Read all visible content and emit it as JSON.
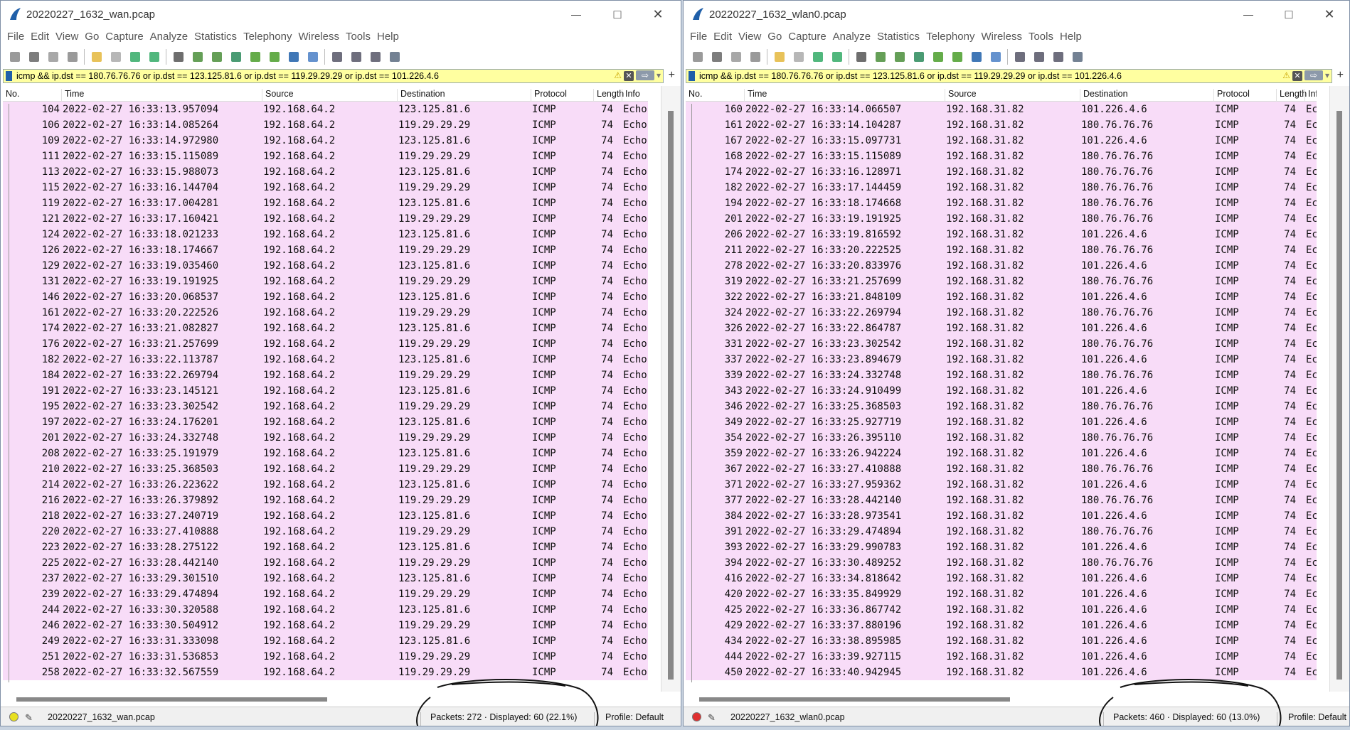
{
  "menu": [
    "File",
    "Edit",
    "View",
    "Go",
    "Capture",
    "Analyze",
    "Statistics",
    "Telephony",
    "Wireless",
    "Tools",
    "Help"
  ],
  "columns": [
    "No.",
    "Time",
    "Source",
    "Destination",
    "Protocol",
    "Length",
    "Info"
  ],
  "filter": "icmp && ip.dst == 180.76.76.76 or ip.dst == 123.125.81.6 or ip.dst == 119.29.29.29 or ip.dst == 101.226.4.6",
  "profile": "Profile: Default",
  "windows": [
    {
      "title": "20220227_1632_wan.pcap",
      "file": "20220227_1632_wan.pcap",
      "stats": "Packets: 272 · Displayed: 60 (22.1%)",
      "led_color": "#e8e020",
      "rows": [
        [
          "104",
          "2022-02-27 16:33:13.957094",
          "192.168.64.2",
          "123.125.81.6",
          "ICMP",
          "74",
          "Echo"
        ],
        [
          "106",
          "2022-02-27 16:33:14.085264",
          "192.168.64.2",
          "119.29.29.29",
          "ICMP",
          "74",
          "Echo"
        ],
        [
          "109",
          "2022-02-27 16:33:14.972980",
          "192.168.64.2",
          "123.125.81.6",
          "ICMP",
          "74",
          "Echo"
        ],
        [
          "111",
          "2022-02-27 16:33:15.115089",
          "192.168.64.2",
          "119.29.29.29",
          "ICMP",
          "74",
          "Echo"
        ],
        [
          "113",
          "2022-02-27 16:33:15.988073",
          "192.168.64.2",
          "123.125.81.6",
          "ICMP",
          "74",
          "Echo"
        ],
        [
          "115",
          "2022-02-27 16:33:16.144704",
          "192.168.64.2",
          "119.29.29.29",
          "ICMP",
          "74",
          "Echo"
        ],
        [
          "119",
          "2022-02-27 16:33:17.004281",
          "192.168.64.2",
          "123.125.81.6",
          "ICMP",
          "74",
          "Echo"
        ],
        [
          "121",
          "2022-02-27 16:33:17.160421",
          "192.168.64.2",
          "119.29.29.29",
          "ICMP",
          "74",
          "Echo"
        ],
        [
          "124",
          "2022-02-27 16:33:18.021233",
          "192.168.64.2",
          "123.125.81.6",
          "ICMP",
          "74",
          "Echo"
        ],
        [
          "126",
          "2022-02-27 16:33:18.174667",
          "192.168.64.2",
          "119.29.29.29",
          "ICMP",
          "74",
          "Echo"
        ],
        [
          "129",
          "2022-02-27 16:33:19.035460",
          "192.168.64.2",
          "123.125.81.6",
          "ICMP",
          "74",
          "Echo"
        ],
        [
          "131",
          "2022-02-27 16:33:19.191925",
          "192.168.64.2",
          "119.29.29.29",
          "ICMP",
          "74",
          "Echo"
        ],
        [
          "146",
          "2022-02-27 16:33:20.068537",
          "192.168.64.2",
          "123.125.81.6",
          "ICMP",
          "74",
          "Echo"
        ],
        [
          "161",
          "2022-02-27 16:33:20.222526",
          "192.168.64.2",
          "119.29.29.29",
          "ICMP",
          "74",
          "Echo"
        ],
        [
          "174",
          "2022-02-27 16:33:21.082827",
          "192.168.64.2",
          "123.125.81.6",
          "ICMP",
          "74",
          "Echo"
        ],
        [
          "176",
          "2022-02-27 16:33:21.257699",
          "192.168.64.2",
          "119.29.29.29",
          "ICMP",
          "74",
          "Echo"
        ],
        [
          "182",
          "2022-02-27 16:33:22.113787",
          "192.168.64.2",
          "123.125.81.6",
          "ICMP",
          "74",
          "Echo"
        ],
        [
          "184",
          "2022-02-27 16:33:22.269794",
          "192.168.64.2",
          "119.29.29.29",
          "ICMP",
          "74",
          "Echo"
        ],
        [
          "191",
          "2022-02-27 16:33:23.145121",
          "192.168.64.2",
          "123.125.81.6",
          "ICMP",
          "74",
          "Echo"
        ],
        [
          "195",
          "2022-02-27 16:33:23.302542",
          "192.168.64.2",
          "119.29.29.29",
          "ICMP",
          "74",
          "Echo"
        ],
        [
          "197",
          "2022-02-27 16:33:24.176201",
          "192.168.64.2",
          "123.125.81.6",
          "ICMP",
          "74",
          "Echo"
        ],
        [
          "201",
          "2022-02-27 16:33:24.332748",
          "192.168.64.2",
          "119.29.29.29",
          "ICMP",
          "74",
          "Echo"
        ],
        [
          "208",
          "2022-02-27 16:33:25.191979",
          "192.168.64.2",
          "123.125.81.6",
          "ICMP",
          "74",
          "Echo"
        ],
        [
          "210",
          "2022-02-27 16:33:25.368503",
          "192.168.64.2",
          "119.29.29.29",
          "ICMP",
          "74",
          "Echo"
        ],
        [
          "214",
          "2022-02-27 16:33:26.223622",
          "192.168.64.2",
          "123.125.81.6",
          "ICMP",
          "74",
          "Echo"
        ],
        [
          "216",
          "2022-02-27 16:33:26.379892",
          "192.168.64.2",
          "119.29.29.29",
          "ICMP",
          "74",
          "Echo"
        ],
        [
          "218",
          "2022-02-27 16:33:27.240719",
          "192.168.64.2",
          "123.125.81.6",
          "ICMP",
          "74",
          "Echo"
        ],
        [
          "220",
          "2022-02-27 16:33:27.410888",
          "192.168.64.2",
          "119.29.29.29",
          "ICMP",
          "74",
          "Echo"
        ],
        [
          "223",
          "2022-02-27 16:33:28.275122",
          "192.168.64.2",
          "123.125.81.6",
          "ICMP",
          "74",
          "Echo"
        ],
        [
          "225",
          "2022-02-27 16:33:28.442140",
          "192.168.64.2",
          "119.29.29.29",
          "ICMP",
          "74",
          "Echo"
        ],
        [
          "237",
          "2022-02-27 16:33:29.301510",
          "192.168.64.2",
          "123.125.81.6",
          "ICMP",
          "74",
          "Echo"
        ],
        [
          "239",
          "2022-02-27 16:33:29.474894",
          "192.168.64.2",
          "119.29.29.29",
          "ICMP",
          "74",
          "Echo"
        ],
        [
          "244",
          "2022-02-27 16:33:30.320588",
          "192.168.64.2",
          "123.125.81.6",
          "ICMP",
          "74",
          "Echo"
        ],
        [
          "246",
          "2022-02-27 16:33:30.504912",
          "192.168.64.2",
          "119.29.29.29",
          "ICMP",
          "74",
          "Echo"
        ],
        [
          "249",
          "2022-02-27 16:33:31.333098",
          "192.168.64.2",
          "123.125.81.6",
          "ICMP",
          "74",
          "Echo"
        ],
        [
          "251",
          "2022-02-27 16:33:31.536853",
          "192.168.64.2",
          "119.29.29.29",
          "ICMP",
          "74",
          "Echo"
        ],
        [
          "258",
          "2022-02-27 16:33:32.567559",
          "192.168.64.2",
          "119.29.29.29",
          "ICMP",
          "74",
          "Echo"
        ]
      ]
    },
    {
      "title": "20220227_1632_wlan0.pcap",
      "file": "20220227_1632_wlan0.pcap",
      "stats": "Packets: 460 · Displayed: 60 (13.0%)",
      "led_color": "#e03030",
      "rows": [
        [
          "160",
          "2022-02-27 16:33:14.066507",
          "192.168.31.82",
          "101.226.4.6",
          "ICMP",
          "74",
          "Echo"
        ],
        [
          "161",
          "2022-02-27 16:33:14.104287",
          "192.168.31.82",
          "180.76.76.76",
          "ICMP",
          "74",
          "Echo"
        ],
        [
          "167",
          "2022-02-27 16:33:15.097731",
          "192.168.31.82",
          "101.226.4.6",
          "ICMP",
          "74",
          "Echo"
        ],
        [
          "168",
          "2022-02-27 16:33:15.115089",
          "192.168.31.82",
          "180.76.76.76",
          "ICMP",
          "74",
          "Echo"
        ],
        [
          "174",
          "2022-02-27 16:33:16.128971",
          "192.168.31.82",
          "180.76.76.76",
          "ICMP",
          "74",
          "Echo"
        ],
        [
          "182",
          "2022-02-27 16:33:17.144459",
          "192.168.31.82",
          "180.76.76.76",
          "ICMP",
          "74",
          "Echo"
        ],
        [
          "194",
          "2022-02-27 16:33:18.174668",
          "192.168.31.82",
          "180.76.76.76",
          "ICMP",
          "74",
          "Echo"
        ],
        [
          "201",
          "2022-02-27 16:33:19.191925",
          "192.168.31.82",
          "180.76.76.76",
          "ICMP",
          "74",
          "Echo"
        ],
        [
          "206",
          "2022-02-27 16:33:19.816592",
          "192.168.31.82",
          "101.226.4.6",
          "ICMP",
          "74",
          "Echo"
        ],
        [
          "211",
          "2022-02-27 16:33:20.222525",
          "192.168.31.82",
          "180.76.76.76",
          "ICMP",
          "74",
          "Echo"
        ],
        [
          "278",
          "2022-02-27 16:33:20.833976",
          "192.168.31.82",
          "101.226.4.6",
          "ICMP",
          "74",
          "Echo"
        ],
        [
          "319",
          "2022-02-27 16:33:21.257699",
          "192.168.31.82",
          "180.76.76.76",
          "ICMP",
          "74",
          "Echo"
        ],
        [
          "322",
          "2022-02-27 16:33:21.848109",
          "192.168.31.82",
          "101.226.4.6",
          "ICMP",
          "74",
          "Echo"
        ],
        [
          "324",
          "2022-02-27 16:33:22.269794",
          "192.168.31.82",
          "180.76.76.76",
          "ICMP",
          "74",
          "Echo"
        ],
        [
          "326",
          "2022-02-27 16:33:22.864787",
          "192.168.31.82",
          "101.226.4.6",
          "ICMP",
          "74",
          "Echo"
        ],
        [
          "331",
          "2022-02-27 16:33:23.302542",
          "192.168.31.82",
          "180.76.76.76",
          "ICMP",
          "74",
          "Echo"
        ],
        [
          "337",
          "2022-02-27 16:33:23.894679",
          "192.168.31.82",
          "101.226.4.6",
          "ICMP",
          "74",
          "Echo"
        ],
        [
          "339",
          "2022-02-27 16:33:24.332748",
          "192.168.31.82",
          "180.76.76.76",
          "ICMP",
          "74",
          "Echo"
        ],
        [
          "343",
          "2022-02-27 16:33:24.910499",
          "192.168.31.82",
          "101.226.4.6",
          "ICMP",
          "74",
          "Echo"
        ],
        [
          "346",
          "2022-02-27 16:33:25.368503",
          "192.168.31.82",
          "180.76.76.76",
          "ICMP",
          "74",
          "Echo"
        ],
        [
          "349",
          "2022-02-27 16:33:25.927719",
          "192.168.31.82",
          "101.226.4.6",
          "ICMP",
          "74",
          "Echo"
        ],
        [
          "354",
          "2022-02-27 16:33:26.395110",
          "192.168.31.82",
          "180.76.76.76",
          "ICMP",
          "74",
          "Echo"
        ],
        [
          "359",
          "2022-02-27 16:33:26.942224",
          "192.168.31.82",
          "101.226.4.6",
          "ICMP",
          "74",
          "Echo"
        ],
        [
          "367",
          "2022-02-27 16:33:27.410888",
          "192.168.31.82",
          "180.76.76.76",
          "ICMP",
          "74",
          "Echo"
        ],
        [
          "371",
          "2022-02-27 16:33:27.959362",
          "192.168.31.82",
          "101.226.4.6",
          "ICMP",
          "74",
          "Echo"
        ],
        [
          "377",
          "2022-02-27 16:33:28.442140",
          "192.168.31.82",
          "180.76.76.76",
          "ICMP",
          "74",
          "Echo"
        ],
        [
          "384",
          "2022-02-27 16:33:28.973541",
          "192.168.31.82",
          "101.226.4.6",
          "ICMP",
          "74",
          "Echo"
        ],
        [
          "391",
          "2022-02-27 16:33:29.474894",
          "192.168.31.82",
          "180.76.76.76",
          "ICMP",
          "74",
          "Echo"
        ],
        [
          "393",
          "2022-02-27 16:33:29.990783",
          "192.168.31.82",
          "101.226.4.6",
          "ICMP",
          "74",
          "Echo"
        ],
        [
          "394",
          "2022-02-27 16:33:30.489252",
          "192.168.31.82",
          "180.76.76.76",
          "ICMP",
          "74",
          "Echo"
        ],
        [
          "416",
          "2022-02-27 16:33:34.818642",
          "192.168.31.82",
          "101.226.4.6",
          "ICMP",
          "74",
          "Echo"
        ],
        [
          "420",
          "2022-02-27 16:33:35.849929",
          "192.168.31.82",
          "101.226.4.6",
          "ICMP",
          "74",
          "Echo"
        ],
        [
          "425",
          "2022-02-27 16:33:36.867742",
          "192.168.31.82",
          "101.226.4.6",
          "ICMP",
          "74",
          "Echo"
        ],
        [
          "429",
          "2022-02-27 16:33:37.880196",
          "192.168.31.82",
          "101.226.4.6",
          "ICMP",
          "74",
          "Echo"
        ],
        [
          "434",
          "2022-02-27 16:33:38.895985",
          "192.168.31.82",
          "101.226.4.6",
          "ICMP",
          "74",
          "Echo"
        ],
        [
          "444",
          "2022-02-27 16:33:39.927115",
          "192.168.31.82",
          "101.226.4.6",
          "ICMP",
          "74",
          "Echo"
        ],
        [
          "450",
          "2022-02-27 16:33:40.942945",
          "192.168.31.82",
          "101.226.4.6",
          "ICMP",
          "74",
          "Echo"
        ]
      ]
    }
  ]
}
